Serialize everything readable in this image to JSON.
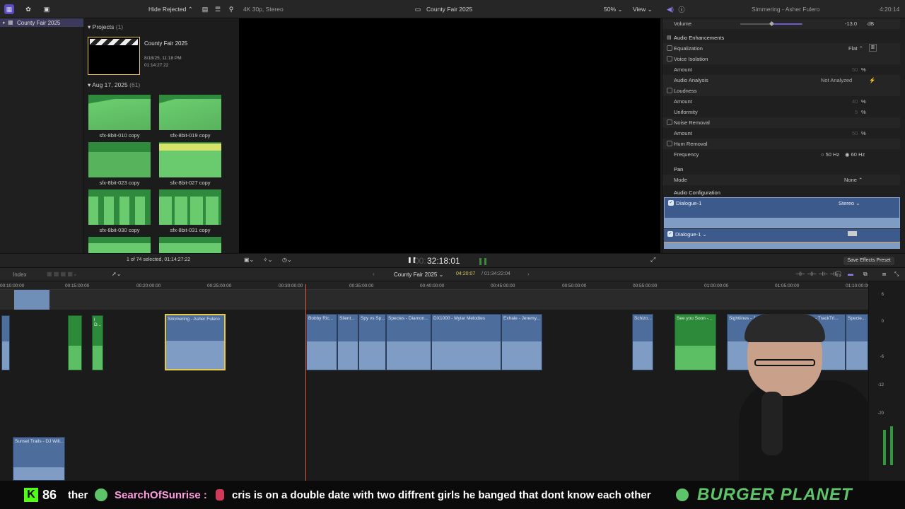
{
  "topbar": {
    "hide_rejected": "Hide Rejected",
    "format": "4K 30p, Stereo",
    "project_title": "County Fair 2025",
    "zoom": "50%",
    "view": "View",
    "inspector_title": "Simmering - Asher Fulero",
    "duration": "4:20:14"
  },
  "sidebar": {
    "library": "County Fair 2025"
  },
  "browser": {
    "projects_label": "Projects",
    "projects_count": "(1)",
    "project": {
      "name": "County Fair 2025",
      "date": "8/18/25, 11:18 PM",
      "duration": "01:14:27:22"
    },
    "group_label": "Aug 17, 2025",
    "group_count": "(61)",
    "clips": [
      {
        "name": "sfx-8bit-010 copy"
      },
      {
        "name": "sfx-8bit-019 copy"
      },
      {
        "name": "sfx-8bit-023 copy"
      },
      {
        "name": "sfx-8bit-027 copy"
      },
      {
        "name": "sfx-8bit-030 copy"
      },
      {
        "name": "sfx-8bit-031 copy"
      }
    ],
    "selection_status": "1 of 74 selected, 01:14:27:22"
  },
  "viewer": {
    "timecode": "32:18:01",
    "timecode_dim": "00:"
  },
  "inspector": {
    "volume_label": "Volume",
    "volume_value": "-13.0",
    "volume_unit": "dB",
    "enhancements": "Audio Enhancements",
    "equalization": "Equalization",
    "eq_value": "Flat",
    "voice_isolation": "Voice Isolation",
    "amount": "Amount",
    "vi_amount": "50",
    "percent": "%",
    "audio_analysis": "Audio Analysis",
    "analysis_value": "Not Analyzed",
    "loudness": "Loudness",
    "loud_amount": "40",
    "uniformity": "Uniformity",
    "uniformity_value": "5",
    "noise_removal": "Noise Removal",
    "noise_amount": "50",
    "hum_removal": "Hum Removal",
    "frequency": "Frequency",
    "freq_50": "50 Hz",
    "freq_60": "60 Hz",
    "pan": "Pan",
    "mode": "Mode",
    "mode_value": "None",
    "audio_config": "Audio Configuration",
    "dialogue1": "Dialogue-1",
    "stereo": "Stereo",
    "dialogue2": "Dialogue-1",
    "save_preset": "Save Effects Preset"
  },
  "timeline_bar": {
    "index": "Index",
    "project": "County Fair 2025",
    "position": "04:20:07",
    "total": "/ 01:34:22:04"
  },
  "ruler": [
    "00:10:00:00",
    "00:15:00:00",
    "00:20:00:00",
    "00:25:00:00",
    "00:30:00:00",
    "00:35:00:00",
    "00:40:00:00",
    "00:45:00:00",
    "00:50:00:00",
    "00:55:00:00",
    "01:00:00:00",
    "01:05:00:00",
    "01:10:00:00"
  ],
  "clips": {
    "c1": "l D...",
    "c2": "Simmering - Asher Fulero",
    "c3": "Bobby Ric...",
    "c4": "Silent...",
    "c5": "Spy vs Sp...",
    "c6": "Species - Diamon...",
    "c7": "DX1000 - Mylar Melodies",
    "c8": "Exhale - Jeremy...",
    "c9": "Schizo...",
    "c10": "See you Soon -...",
    "c11": "Sightlines - Jeremy Bl...",
    "c12": "Freddy - TrackTri...",
    "c13": "Specie...",
    "c14": "Sunset Trails - DJ Will..."
  },
  "meter_labels": [
    "6",
    "0",
    "-6",
    "-12",
    "-20"
  ],
  "ticker": {
    "count": "86",
    "prev": "ther",
    "user": "SearchOfSunrise :",
    "message": "cris is on a double date with two diffrent girls he banged that dont know each other",
    "brand": "BURGER PLANET"
  },
  "colors": {
    "accent": "#6b5bd6",
    "clip_blue": "#4d6e9c",
    "clip_green": "#2e8a3b",
    "playhead": "#e0593a"
  }
}
